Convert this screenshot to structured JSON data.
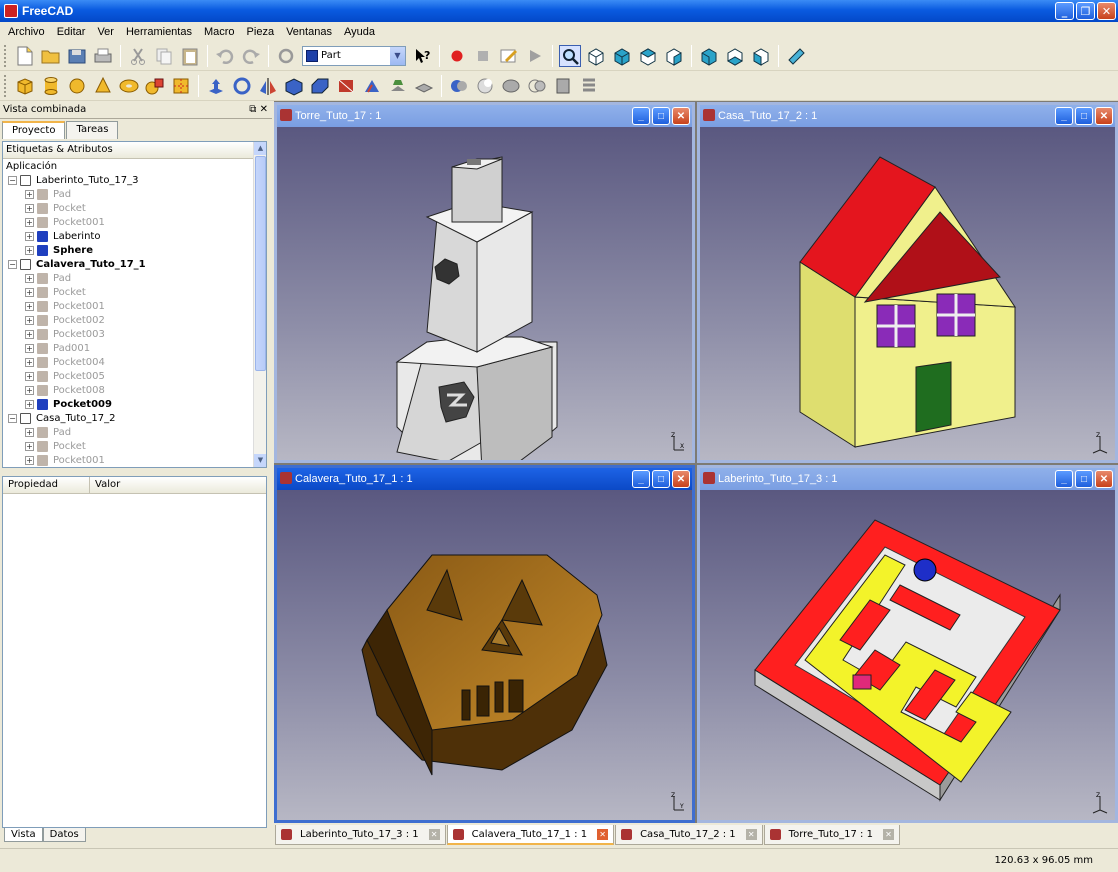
{
  "app": {
    "title": "FreeCAD"
  },
  "menu": [
    "Archivo",
    "Editar",
    "Ver",
    "Herramientas",
    "Macro",
    "Pieza",
    "Ventanas",
    "Ayuda"
  ],
  "workbench": {
    "selected": "Part"
  },
  "panel": {
    "title": "Vista combinada",
    "tabs": [
      "Proyecto",
      "Tareas"
    ],
    "tree_header": "Etiquetas & Atributos",
    "tree": [
      {
        "label": "Aplicación",
        "level": 0,
        "kind": "root"
      },
      {
        "label": "Laberinto_Tuto_17_3",
        "level": 1,
        "kind": "doc"
      },
      {
        "label": "Pad",
        "level": 2,
        "kind": "gray"
      },
      {
        "label": "Pocket",
        "level": 2,
        "kind": "gray"
      },
      {
        "label": "Pocket001",
        "level": 2,
        "kind": "gray"
      },
      {
        "label": "Laberinto",
        "level": 2,
        "kind": "blue"
      },
      {
        "label": "Sphere",
        "level": 2,
        "kind": "blue-bold"
      },
      {
        "label": "Calavera_Tuto_17_1",
        "level": 1,
        "kind": "doc-bold"
      },
      {
        "label": "Pad",
        "level": 2,
        "kind": "gray"
      },
      {
        "label": "Pocket",
        "level": 2,
        "kind": "gray"
      },
      {
        "label": "Pocket001",
        "level": 2,
        "kind": "gray"
      },
      {
        "label": "Pocket002",
        "level": 2,
        "kind": "gray"
      },
      {
        "label": "Pocket003",
        "level": 2,
        "kind": "gray"
      },
      {
        "label": "Pad001",
        "level": 2,
        "kind": "gray"
      },
      {
        "label": "Pocket004",
        "level": 2,
        "kind": "gray"
      },
      {
        "label": "Pocket005",
        "level": 2,
        "kind": "gray"
      },
      {
        "label": "Pocket008",
        "level": 2,
        "kind": "gray"
      },
      {
        "label": "Pocket009",
        "level": 2,
        "kind": "blue-bold"
      },
      {
        "label": "Casa_Tuto_17_2",
        "level": 1,
        "kind": "doc"
      },
      {
        "label": "Pad",
        "level": 2,
        "kind": "gray"
      },
      {
        "label": "Pocket",
        "level": 2,
        "kind": "gray"
      },
      {
        "label": "Pocket001",
        "level": 2,
        "kind": "gray"
      }
    ],
    "prop_headers": [
      "Propiedad",
      "Valor"
    ],
    "bottom_tabs": [
      "Vista",
      "Datos"
    ]
  },
  "windows": {
    "torre": "Torre_Tuto_17 : 1",
    "casa": "Casa_Tuto_17_2 : 1",
    "calavera": "Calavera_Tuto_17_1 : 1",
    "laberinto": "Laberinto_Tuto_17_3 : 1"
  },
  "doc_tabs": [
    {
      "label": "Laberinto_Tuto_17_3 : 1",
      "active": false
    },
    {
      "label": "Calavera_Tuto_17_1 : 1",
      "active": true
    },
    {
      "label": "Casa_Tuto_17_2 : 1",
      "active": false
    },
    {
      "label": "Torre_Tuto_17 : 1",
      "active": false
    }
  ],
  "status": {
    "coords": "120.63 x 96.05 mm"
  },
  "colors": {
    "titlebar": "#0a5be0",
    "view_top": "#5a5880",
    "view_bottom": "#b7b7c4",
    "roof": "#e0141e",
    "wall": "#eded83",
    "maze_red": "#ff1f1f",
    "maze_yellow": "#f3f32a",
    "skull": "#8b5a17"
  }
}
